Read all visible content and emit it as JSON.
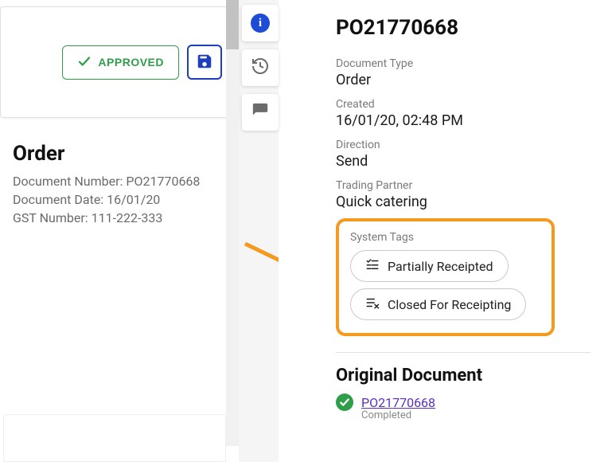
{
  "left": {
    "approved_label": "APPROVED",
    "title": "Order",
    "doc_number_label": "Document Number:",
    "doc_number_value": "PO21770668",
    "doc_date_label": "Document Date:",
    "doc_date_value": "16/01/20",
    "gst_label": "GST Number:",
    "gst_value": "111-222-333"
  },
  "right": {
    "po_title": "PO21770668",
    "doc_type_label": "Document Type",
    "doc_type_value": "Order",
    "created_label": "Created",
    "created_value": "16/01/20, 02:48 PM",
    "direction_label": "Direction",
    "direction_value": "Send",
    "partner_label": "Trading Partner",
    "partner_value": "Quick catering",
    "system_tags_label": "System Tags",
    "tags": {
      "0": {
        "label": "Partially Receipted"
      },
      "1": {
        "label": "Closed For Receipting"
      }
    },
    "original_title": "Original Document",
    "original_link": "PO21770668",
    "original_status": "Completed"
  }
}
